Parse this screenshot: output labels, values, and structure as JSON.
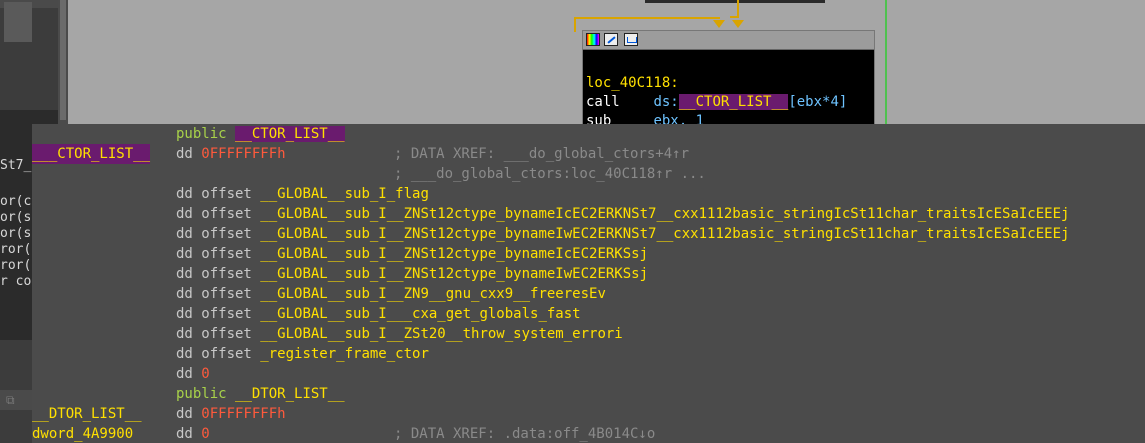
{
  "left_panel": {
    "fragments": [
      "St7_",
      "or(ch",
      "or(st",
      "or(st",
      "ror()",
      "ror()",
      "r con"
    ],
    "bottom_icon": "copy-icon"
  },
  "graph_node": {
    "title_icons": [
      "color-palette-icon",
      "edit-icon",
      "graph-icon"
    ],
    "label": "loc_40C118:",
    "line1": {
      "mnemonic": "call",
      "seg": "ds:",
      "symbol": "__CTOR_LIST__",
      "operand": "[ebx*4]"
    },
    "line2": {
      "mnemonic": "sub",
      "operand": "ebx, 1"
    }
  },
  "hint": {
    "rows": [
      {
        "label": "",
        "label_hl": false,
        "kw": "public",
        "kw_green": true,
        "operand": "__CTOR_LIST__",
        "operand_kind": "sym-hl",
        "comment": ""
      },
      {
        "label": "___CTOR_LIST__",
        "label_hl": true,
        "kw": "dd",
        "kw_green": false,
        "operand": "0FFFFFFFFh",
        "operand_kind": "num",
        "comment": "; DATA XREF: ___do_global_ctors+4↑r"
      },
      {
        "label": "",
        "label_hl": false,
        "kw": "",
        "kw_green": false,
        "operand": "",
        "operand_kind": "",
        "comment": "; ___do_global_ctors:loc_40C118↑r ..."
      },
      {
        "label": "",
        "label_hl": false,
        "kw": "dd offset",
        "kw_green": false,
        "operand": "__GLOBAL__sub_I_flag",
        "operand_kind": "sym",
        "comment": ""
      },
      {
        "label": "",
        "label_hl": false,
        "kw": "dd offset",
        "kw_green": false,
        "operand": "__GLOBAL__sub_I__ZNSt12ctype_bynameIcEC2ERKNSt7__cxx1112basic_stringIcSt11char_traitsIcESaIcEEEj",
        "operand_kind": "sym",
        "comment": ""
      },
      {
        "label": "",
        "label_hl": false,
        "kw": "dd offset",
        "kw_green": false,
        "operand": "__GLOBAL__sub_I__ZNSt12ctype_bynameIwEC2ERKNSt7__cxx1112basic_stringIcSt11char_traitsIcESaIcEEEj",
        "operand_kind": "sym",
        "comment": ""
      },
      {
        "label": "",
        "label_hl": false,
        "kw": "dd offset",
        "kw_green": false,
        "operand": "__GLOBAL__sub_I__ZNSt12ctype_bynameIcEC2ERKSsj",
        "operand_kind": "sym",
        "comment": ""
      },
      {
        "label": "",
        "label_hl": false,
        "kw": "dd offset",
        "kw_green": false,
        "operand": "__GLOBAL__sub_I__ZNSt12ctype_bynameIwEC2ERKSsj",
        "operand_kind": "sym",
        "comment": ""
      },
      {
        "label": "",
        "label_hl": false,
        "kw": "dd offset",
        "kw_green": false,
        "operand": "__GLOBAL__sub_I__ZN9__gnu_cxx9__freeresEv",
        "operand_kind": "sym",
        "comment": ""
      },
      {
        "label": "",
        "label_hl": false,
        "kw": "dd offset",
        "kw_green": false,
        "operand": "__GLOBAL__sub_I___cxa_get_globals_fast",
        "operand_kind": "sym",
        "comment": ""
      },
      {
        "label": "",
        "label_hl": false,
        "kw": "dd offset",
        "kw_green": false,
        "operand": "__GLOBAL__sub_I__ZSt20__throw_system_errori",
        "operand_kind": "sym",
        "comment": ""
      },
      {
        "label": "",
        "label_hl": false,
        "kw": "dd offset",
        "kw_green": false,
        "operand": "_register_frame_ctor",
        "operand_kind": "sym",
        "comment": ""
      },
      {
        "label": "",
        "label_hl": false,
        "kw": "dd",
        "kw_green": false,
        "operand": "0",
        "operand_kind": "num",
        "comment": ""
      },
      {
        "label": "",
        "label_hl": false,
        "kw": "public",
        "kw_green": true,
        "operand": "__DTOR_LIST__",
        "operand_kind": "sym",
        "comment": ""
      },
      {
        "label": "__DTOR_LIST__",
        "label_hl": false,
        "kw": "dd",
        "kw_green": false,
        "operand": "0FFFFFFFFh",
        "operand_kind": "num",
        "comment": ""
      },
      {
        "label": "dword_4A9900",
        "label_hl": false,
        "kw": "dd",
        "kw_green": false,
        "operand": "0",
        "operand_kind": "num",
        "comment": "; DATA XREF: .data:off_4B014C↓o"
      }
    ]
  }
}
